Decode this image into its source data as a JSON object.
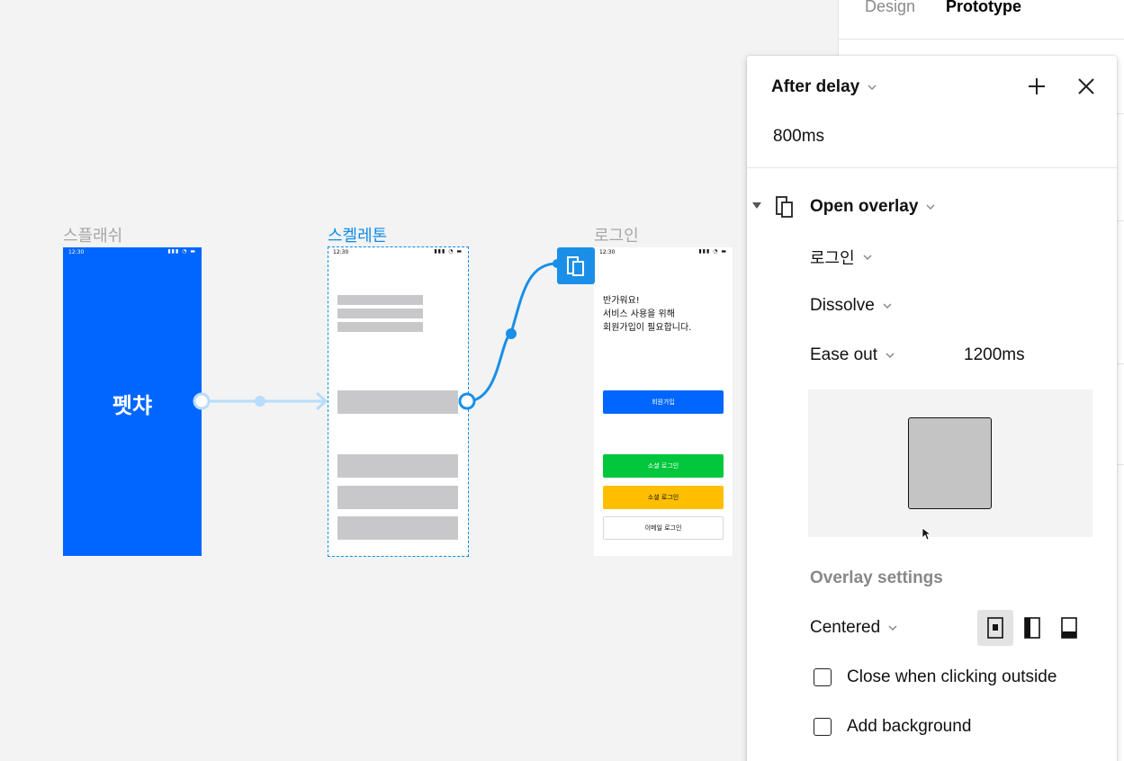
{
  "canvas": {
    "frames": [
      {
        "label": "스플래쉬",
        "title": "펫챠",
        "time": "12:30"
      },
      {
        "label": "스켈레톤",
        "time": "12:30"
      },
      {
        "label": "로그인",
        "time": "12:30",
        "greeting": "반가워요!\n서비스 사용을 위해\n회원가입이 필요합니다.",
        "buttons": [
          {
            "label": "회원가입",
            "bg": "#0066ff",
            "fg": "#ffffff"
          },
          {
            "label": "소셜 로그인",
            "bg": "#00c73c",
            "fg": "#ffffff"
          },
          {
            "label": "소셜 로그인",
            "bg": "#ffbe00",
            "fg": "#111111"
          },
          {
            "label": "이메일 로그인",
            "bg": "#ffffff",
            "fg": "#111111"
          }
        ]
      }
    ]
  },
  "panel": {
    "tabs": {
      "design": "Design",
      "prototype": "Prototype"
    }
  },
  "interaction": {
    "trigger": "After delay",
    "delay": "800ms",
    "action": "Open overlay",
    "destination": "로그인",
    "animation": "Dissolve",
    "easing": "Ease out",
    "duration": "1200ms",
    "overlay_settings_title": "Overlay settings",
    "position": "Centered",
    "close_outside_label": "Close when clicking outside",
    "add_background_label": "Add background",
    "close_outside_checked": false,
    "add_background_checked": false
  },
  "colors": {
    "accent": "#0c8ce9",
    "splash_bg": "#0066ff",
    "canvas_bg": "#f3f3f3"
  }
}
